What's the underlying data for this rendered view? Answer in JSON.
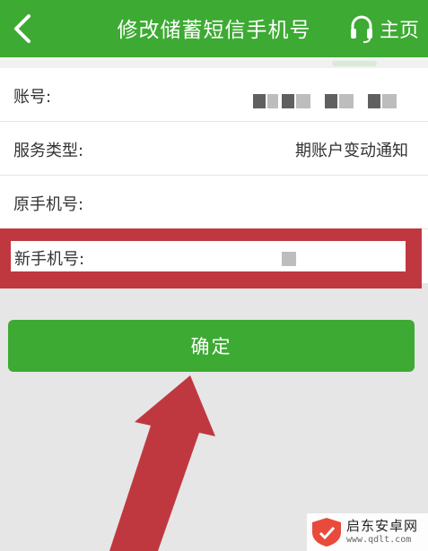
{
  "header": {
    "title": "修改储蓄短信手机号",
    "home_label": "主页"
  },
  "form": {
    "account_label": "账号:",
    "service_label": "服务类型:",
    "service_value": "期账户变动通知",
    "old_phone_label": "原手机号:",
    "new_phone_label": "新手机号:"
  },
  "confirm": {
    "label": "确定"
  },
  "watermark": {
    "name": "启东安卓网",
    "url": "www.qdlt.com"
  },
  "colors": {
    "brand": "#3daa33",
    "highlight": "#c0383f"
  }
}
